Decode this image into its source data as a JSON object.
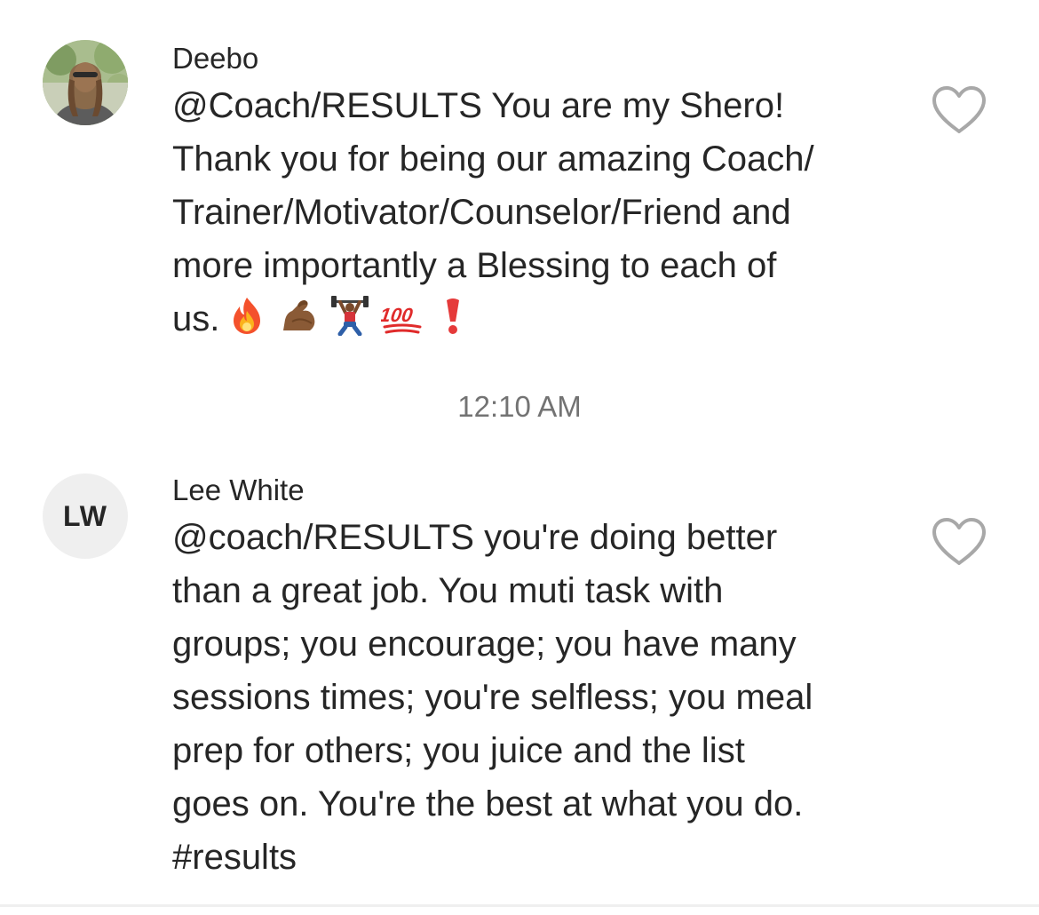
{
  "comments": [
    {
      "username": "Deebo",
      "avatar": "photo-avatar",
      "text": "@Coach/RESULTS You are my Shero!\nThank you for being our amazing Coach/\nTrainer/Motivator/Counselor/Friend and\nmore importantly a Blessing to each of\nus.",
      "emojis": [
        "fire-emoji",
        "flexed-biceps-emoji",
        "weight-lifter-emoji",
        "hundred-points-emoji",
        "exclamation-emoji"
      ],
      "like_icon": "heart-outline-icon"
    },
    {
      "username": "Lee White",
      "avatar_initials": "LW",
      "text": "@coach/RESULTS you're doing better\nthan a great job. You muti task with\ngroups; you encourage; you have many\nsessions times; you're selfless; you meal\nprep for others; you juice and the list\ngoes on. You're the best at what you do.\n#results",
      "like_icon": "heart-outline-icon"
    }
  ],
  "timestamp": "12:10 AM",
  "colors": {
    "text": "#262626",
    "secondary": "#737373",
    "avatar_bg": "#efefef",
    "heart_stroke": "#a8a8a8"
  }
}
